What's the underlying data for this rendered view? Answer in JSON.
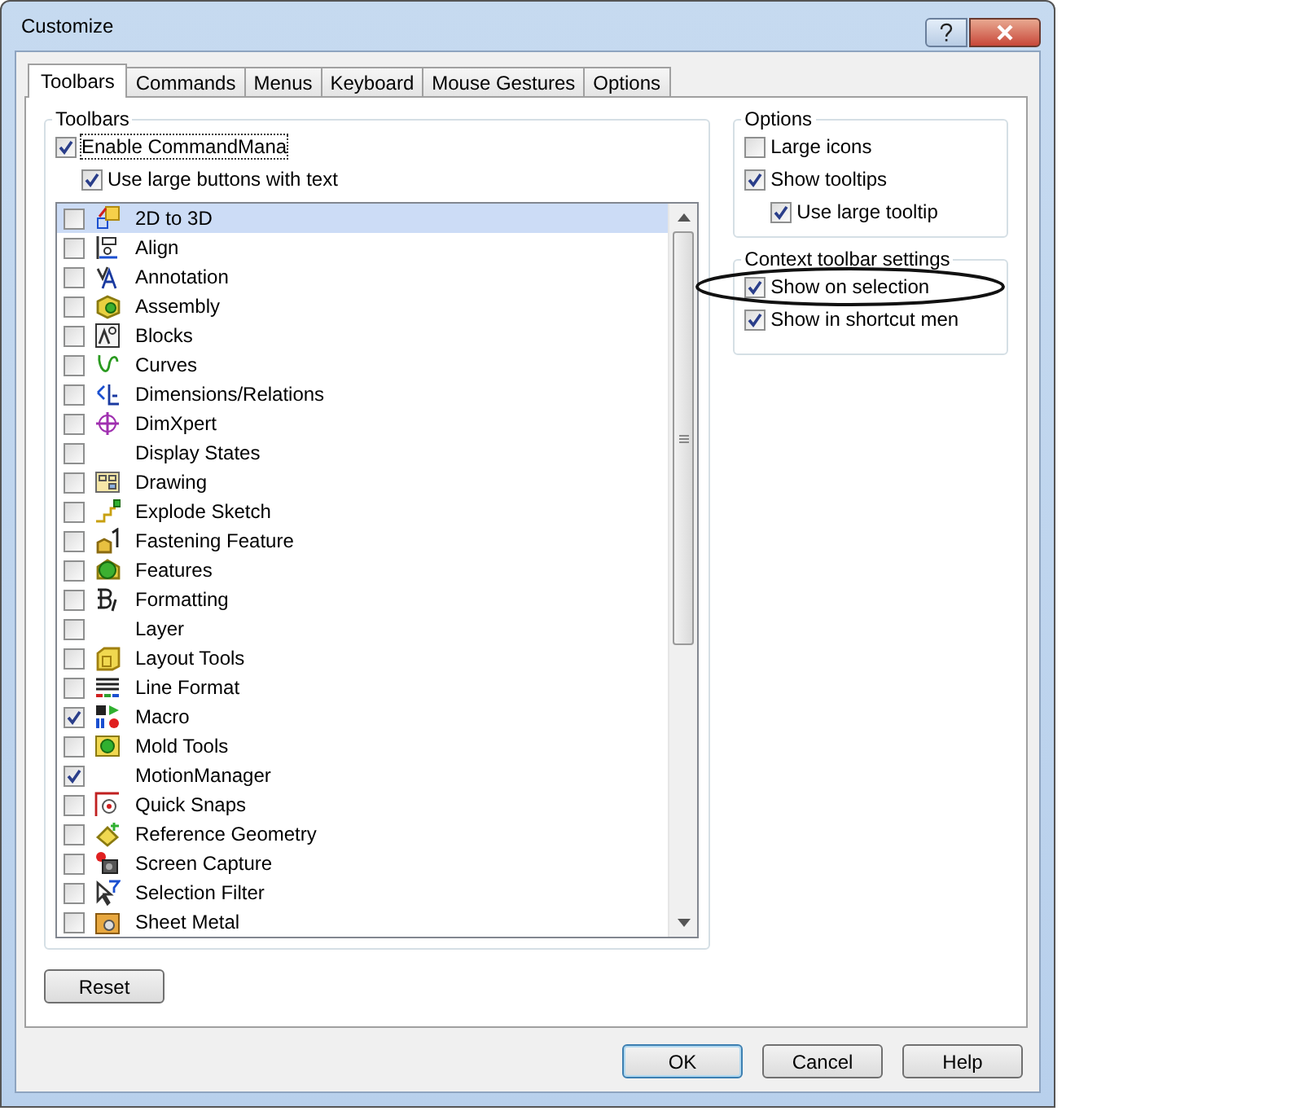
{
  "window": {
    "title": "Customize"
  },
  "tabs": [
    {
      "label": "Toolbars",
      "selected": true
    },
    {
      "label": "Commands",
      "selected": false
    },
    {
      "label": "Menus",
      "selected": false
    },
    {
      "label": "Keyboard",
      "selected": false
    },
    {
      "label": "Mouse Gestures",
      "selected": false
    },
    {
      "label": "Options",
      "selected": false
    }
  ],
  "toolbars_group": {
    "title": "Toolbars",
    "enable_commandmanager": {
      "label": "Enable CommandMana",
      "checked": true
    },
    "large_buttons": {
      "label": "Use large buttons with text",
      "checked": true
    },
    "items": [
      {
        "label": "2D to 3D",
        "checked": false,
        "selected": true
      },
      {
        "label": "Align",
        "checked": false,
        "selected": false
      },
      {
        "label": "Annotation",
        "checked": false,
        "selected": false
      },
      {
        "label": "Assembly",
        "checked": false,
        "selected": false
      },
      {
        "label": "Blocks",
        "checked": false,
        "selected": false
      },
      {
        "label": "Curves",
        "checked": false,
        "selected": false
      },
      {
        "label": "Dimensions/Relations",
        "checked": false,
        "selected": false
      },
      {
        "label": "DimXpert",
        "checked": false,
        "selected": false
      },
      {
        "label": "Display States",
        "checked": false,
        "selected": false
      },
      {
        "label": "Drawing",
        "checked": false,
        "selected": false
      },
      {
        "label": "Explode Sketch",
        "checked": false,
        "selected": false
      },
      {
        "label": "Fastening Feature",
        "checked": false,
        "selected": false
      },
      {
        "label": "Features",
        "checked": false,
        "selected": false
      },
      {
        "label": "Formatting",
        "checked": false,
        "selected": false
      },
      {
        "label": "Layer",
        "checked": false,
        "selected": false
      },
      {
        "label": "Layout Tools",
        "checked": false,
        "selected": false
      },
      {
        "label": "Line Format",
        "checked": false,
        "selected": false
      },
      {
        "label": "Macro",
        "checked": true,
        "selected": false
      },
      {
        "label": "Mold Tools",
        "checked": false,
        "selected": false
      },
      {
        "label": "MotionManager",
        "checked": true,
        "selected": false
      },
      {
        "label": "Quick Snaps",
        "checked": false,
        "selected": false
      },
      {
        "label": "Reference Geometry",
        "checked": false,
        "selected": false
      },
      {
        "label": "Screen Capture",
        "checked": false,
        "selected": false
      },
      {
        "label": "Selection Filter",
        "checked": false,
        "selected": false
      },
      {
        "label": "Sheet Metal",
        "checked": false,
        "selected": false
      }
    ],
    "reset_button": "Reset"
  },
  "options_group": {
    "title": "Options",
    "large_icons": {
      "label": "Large icons",
      "checked": false
    },
    "show_tooltips": {
      "label": "Show tooltips",
      "checked": true
    },
    "large_tooltips": {
      "label": "Use large tooltip",
      "checked": true
    }
  },
  "context_group": {
    "title": "Context toolbar settings",
    "show_on_selection": {
      "label": "Show on selection",
      "checked": true
    },
    "show_in_shortcut_menu": {
      "label": "Show in shortcut men",
      "checked": true
    }
  },
  "buttons": {
    "ok": "OK",
    "cancel": "Cancel",
    "help": "Help"
  }
}
